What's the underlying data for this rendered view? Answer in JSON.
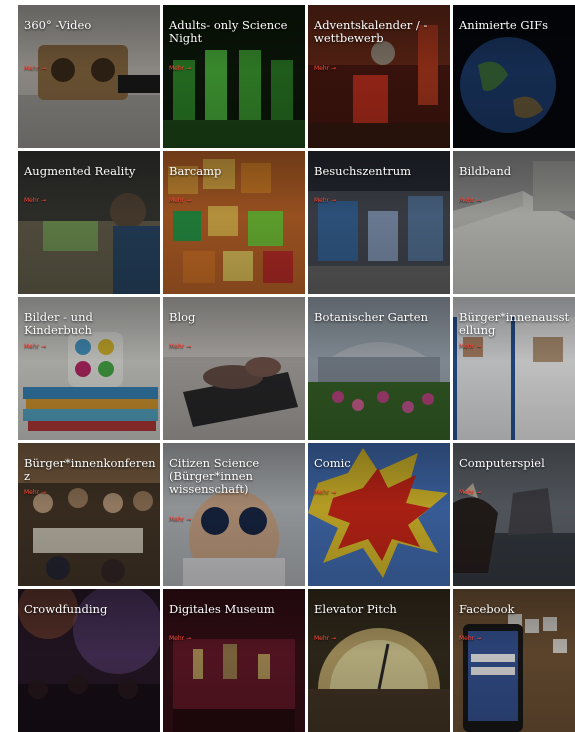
{
  "more_label": "Mehr →",
  "tiles": [
    {
      "title": "360° -Video"
    },
    {
      "title": "Adults- only Science Night"
    },
    {
      "title": "Adventskalender / -wettbewerb"
    },
    {
      "title": "Animierte GIFs"
    },
    {
      "title": "Augmented Reality"
    },
    {
      "title": "Barcamp"
    },
    {
      "title": "Besuchszentrum"
    },
    {
      "title": "Bildband"
    },
    {
      "title": "Bilder - und Kinderbuch"
    },
    {
      "title": "Blog"
    },
    {
      "title": "Botanischer Garten"
    },
    {
      "title": "Bürger*innenausstellung"
    },
    {
      "title": "Bürger*innenkonferenz"
    },
    {
      "title": "Citizen Science (Bürger*innen wissenschaft)"
    },
    {
      "title": "Comic"
    },
    {
      "title": "Computerspiel"
    },
    {
      "title": "Crowdfunding"
    },
    {
      "title": "Digitales Museum"
    },
    {
      "title": "Elevator Pitch"
    },
    {
      "title": "Facebook"
    }
  ]
}
